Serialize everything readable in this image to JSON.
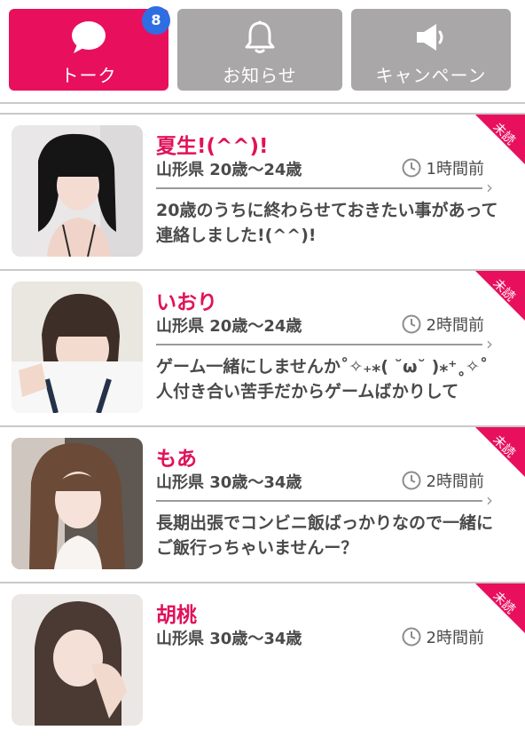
{
  "tabs": [
    {
      "label": "トーク",
      "icon": "chat-bubble-icon",
      "active": true,
      "badge": "8"
    },
    {
      "label": "お知らせ",
      "icon": "bell-icon",
      "active": false
    },
    {
      "label": "キャンペーン",
      "icon": "megaphone-icon",
      "active": false
    }
  ],
  "colors": {
    "accent": "#e8105d",
    "tab_inactive": "#a9a7a8",
    "badge": "#2f6de3",
    "name": "#e0125a"
  },
  "unread_label": "未読",
  "messages": [
    {
      "name": "夏生!(^^)!",
      "meta": "山形県 20歳〜24歳",
      "time": "1時間前",
      "text": "20歳のうちに終わらせておきたい事があって連絡しました!(^^)!"
    },
    {
      "name": "いおり",
      "meta": "山形県 20歳〜24歳",
      "time": "2時間前",
      "text": "ゲーム一緒にしませんか˚✧₊⁎( ˘ω˘ )⁎⁺˳✧˚人付き合い苦手だからゲームばかりして"
    },
    {
      "name": "もあ",
      "meta": "山形県 30歳〜34歳",
      "time": "2時間前",
      "text": "長期出張でコンビニ飯ばっかりなので一緒にご飯行っちゃいませんー？"
    },
    {
      "name": "胡桃",
      "meta": "山形県 30歳〜34歳",
      "time": "2時間前",
      "text": ""
    }
  ]
}
